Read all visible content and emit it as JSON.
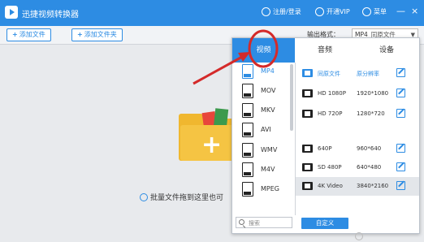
{
  "titlebar": {
    "app_title": "迅捷视频转换器",
    "register_login": "注册/登录",
    "vip": "开通VIP",
    "menu": "菜单",
    "minimize": "—",
    "close": "×"
  },
  "toolbar": {
    "add_file": "添加文件",
    "add_folder": "添加文件夹",
    "output_format_label": "输出格式：",
    "output_format_value": "MP4",
    "output_format_sub": "同原文件"
  },
  "main": {
    "hint": "批量文件拖到这里也可"
  },
  "popup": {
    "tabs": [
      {
        "label": "视频"
      },
      {
        "label": "音频"
      },
      {
        "label": "设备"
      }
    ],
    "formats": [
      {
        "label": "MP4"
      },
      {
        "label": "MOV"
      },
      {
        "label": "MKV"
      },
      {
        "label": "AVI"
      },
      {
        "label": "WMV"
      },
      {
        "label": "M4V"
      },
      {
        "label": "MPEG"
      }
    ],
    "resolutions": [
      {
        "name": "同原文件",
        "res": "原分辨率"
      },
      {
        "name": "HD 1080P",
        "res": "1920*1080"
      },
      {
        "name": "HD 720P",
        "res": "1280*720"
      },
      {
        "name": "640P",
        "res": "960*640"
      },
      {
        "name": "SD 480P",
        "res": "640*480"
      },
      {
        "name": "4K Video",
        "res": "3840*2160"
      }
    ],
    "search_placeholder": "搜索",
    "custom_button": "自定义"
  },
  "colors": {
    "accent": "#2d8ce3",
    "annotation": "#d42a2a",
    "folder": "#f0b72f"
  },
  "icons": [
    "user-icon",
    "vip-icon",
    "menu-icon",
    "minimize-icon",
    "close-icon",
    "video-file-icon",
    "edit-icon",
    "search-icon",
    "folder-add-icon",
    "smile-icon"
  ]
}
